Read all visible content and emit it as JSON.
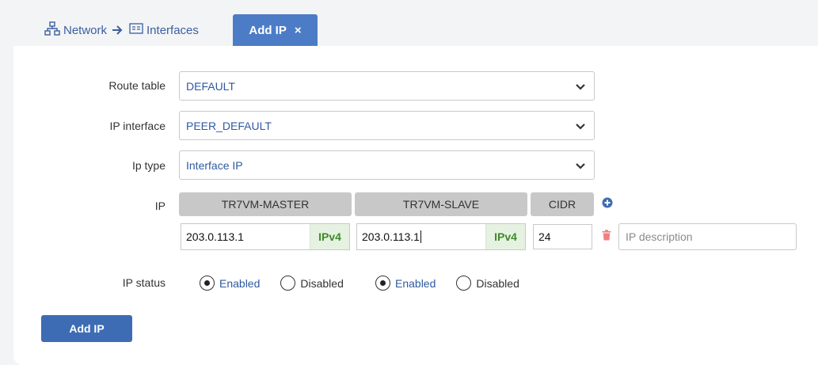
{
  "breadcrumb": {
    "network": "Network",
    "interfaces": "Interfaces"
  },
  "tab": {
    "label": "Add IP",
    "close": "×"
  },
  "form": {
    "route_table": {
      "label": "Route table",
      "value": "DEFAULT"
    },
    "ip_interface": {
      "label": "IP interface",
      "value": "PEER_DEFAULT"
    },
    "ip_type": {
      "label": "Ip type",
      "value": "Interface IP"
    },
    "ip": {
      "label": "IP",
      "headers": {
        "master": "TR7VM-MASTER",
        "slave": "TR7VM-SLAVE",
        "cidr": "CIDR"
      },
      "master_value": "203.0.113.1",
      "master_tag": "IPv4",
      "slave_value": "203.0.113.1",
      "slave_tag": "IPv4",
      "cidr_value": "24",
      "description_placeholder": "IP description"
    },
    "ip_status": {
      "label": "IP status",
      "master": {
        "enabled": "Enabled",
        "disabled": "Disabled",
        "selected": "enabled"
      },
      "slave": {
        "enabled": "Enabled",
        "disabled": "Disabled",
        "selected": "enabled"
      }
    },
    "submit_label": "Add IP"
  },
  "colors": {
    "accent": "#4d7cc7",
    "button": "#3d6cb5",
    "link": "#2f5aa0",
    "ipv4_tag_bg": "#e6f2e1",
    "ipv4_tag_text": "#3f8a2a",
    "delete": "#f08080"
  },
  "icons": {
    "network": "network-icon",
    "interfaces": "interfaces-icon",
    "arrow": "arrow-right-icon",
    "add": "plus-circle-icon",
    "delete": "trash-icon",
    "chevron": "chevron-down-icon"
  }
}
